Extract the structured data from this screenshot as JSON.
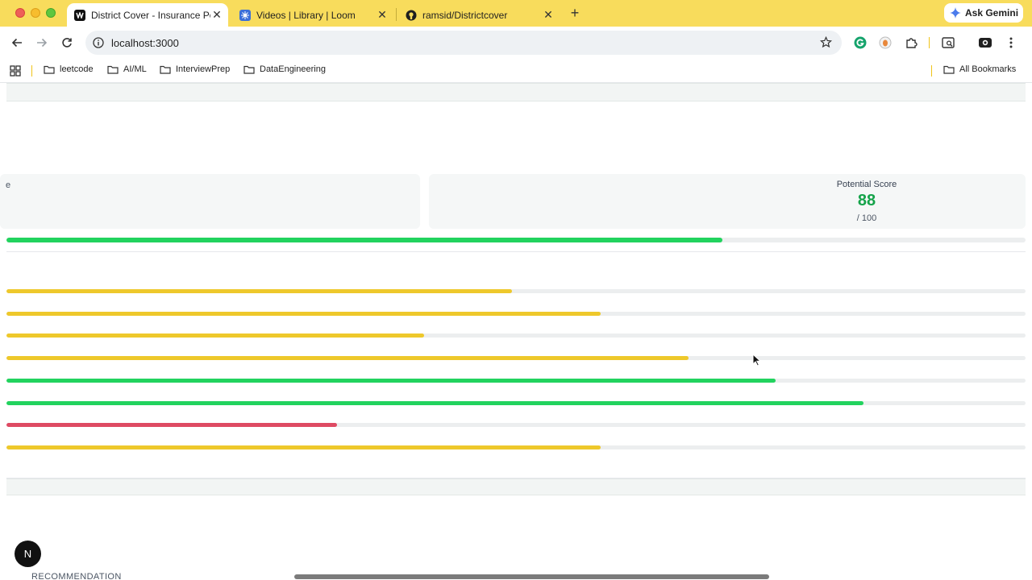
{
  "browser": {
    "tabs": [
      {
        "title": "District Cover - Insurance Policy",
        "active": true,
        "favicon": "district-icon"
      },
      {
        "title": "Videos | Library | Loom",
        "active": false,
        "favicon": "loom-icon"
      },
      {
        "title": "ramsid/Districtcover",
        "active": false,
        "favicon": "github-icon"
      }
    ],
    "ask_gemini": "Ask Gemini",
    "url": "localhost:3000",
    "bookmarks": [
      "leetcode",
      "AI/ML",
      "InterviewPrep",
      "DataEngineering"
    ],
    "all_bookmarks": "All Bookmarks"
  },
  "colors": {
    "green": "#22d35e",
    "yellow": "#eec82b",
    "red": "#de4a63",
    "track": "#eceeef",
    "chrome": "#f8dc5c"
  },
  "score": {
    "left_label_fragment": "e",
    "potential_label": "Potential Score",
    "potential_value": "88",
    "potential_denominator": "/ 100",
    "potential_progress": 0.7025
  },
  "breakdown_bars": [
    {
      "progress": 0.496,
      "status": "yellow"
    },
    {
      "progress": 0.583,
      "status": "yellow"
    },
    {
      "progress": 0.41,
      "status": "yellow"
    },
    {
      "progress": 0.669,
      "status": "yellow"
    },
    {
      "progress": 0.755,
      "status": "green"
    },
    {
      "progress": 0.841,
      "status": "green"
    },
    {
      "progress": 0.324,
      "status": "red"
    },
    {
      "progress": 0.583,
      "status": "yellow"
    }
  ],
  "next_badge": "N",
  "recommendation_label": "RECOMMENDATION"
}
